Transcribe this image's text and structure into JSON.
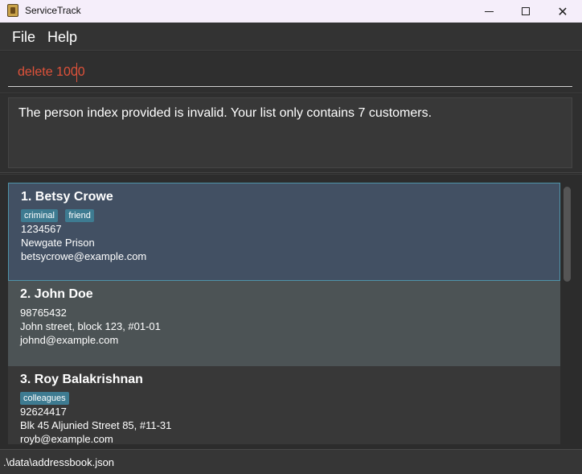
{
  "window": {
    "title": "ServiceTrack",
    "minimize_icon": "minimize-icon",
    "maximize_icon": "maximize-icon",
    "close_icon": "close-icon"
  },
  "menu": {
    "file": "File",
    "help": "Help"
  },
  "command": {
    "value": "delete 1000"
  },
  "result": {
    "message": "The person index provided is invalid. Your list only contains 7 customers."
  },
  "persons": [
    {
      "name": "1. Betsy Crowe",
      "tags": [
        "criminal",
        "friend"
      ],
      "phone": "1234567",
      "address": "Newgate Prison",
      "email": "betsycrowe@example.com"
    },
    {
      "name": "2. John Doe",
      "tags": [],
      "phone": "98765432",
      "address": "John street, block 123, #01-01",
      "email": "johnd@example.com"
    },
    {
      "name": "3. Roy Balakrishnan",
      "tags": [
        "colleagues"
      ],
      "phone": "92624417",
      "address": "Blk 45 Aljunied Street 85, #11-31",
      "email": "royb@example.com"
    }
  ],
  "status": {
    "path": ".\\data\\addressbook.json"
  },
  "colors": {
    "accent": "#e0523a",
    "tag": "#3e7b91",
    "selected": "#425063"
  }
}
